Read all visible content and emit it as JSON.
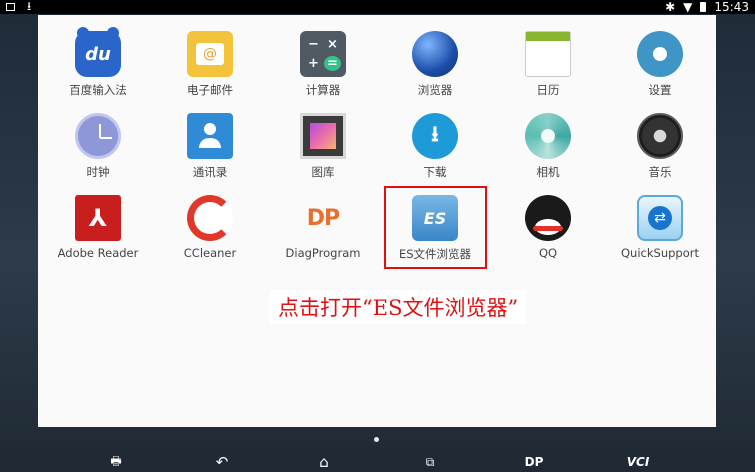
{
  "status_bar": {
    "time": "15:43",
    "icons": [
      "notification-square-icon",
      "download-icon",
      "bluetooth-icon",
      "wifi-icon",
      "battery-icon"
    ]
  },
  "apps": [
    {
      "label": "百度输入法",
      "icon": "baidu-input-icon"
    },
    {
      "label": "电子邮件",
      "icon": "mail-icon"
    },
    {
      "label": "计算器",
      "icon": "calculator-icon"
    },
    {
      "label": "浏览器",
      "icon": "browser-globe-icon"
    },
    {
      "label": "日历",
      "icon": "calendar-icon"
    },
    {
      "label": "设置",
      "icon": "gear-icon"
    },
    {
      "label": "时钟",
      "icon": "clock-icon"
    },
    {
      "label": "通讯录",
      "icon": "contacts-icon"
    },
    {
      "label": "图库",
      "icon": "gallery-icon"
    },
    {
      "label": "下载",
      "icon": "download-icon"
    },
    {
      "label": "相机",
      "icon": "camera-icon"
    },
    {
      "label": "音乐",
      "icon": "music-icon"
    },
    {
      "label": "Adobe Reader",
      "icon": "adobe-reader-icon"
    },
    {
      "label": "CCleaner",
      "icon": "ccleaner-icon"
    },
    {
      "label": "DiagProgram",
      "icon": "dp-logo-icon",
      "glyph": "DP"
    },
    {
      "label": "ES文件浏览器",
      "icon": "es-file-explorer-icon",
      "glyph": "ES"
    },
    {
      "label": "QQ",
      "icon": "qq-penguin-icon"
    },
    {
      "label": "QuickSupport",
      "icon": "quicksupport-icon"
    }
  ],
  "annotation": {
    "text": "点击打开“ES文件浏览器”",
    "color": "#e01010"
  },
  "nav_bar": {
    "buttons": [
      {
        "name": "printer-icon",
        "glyph": "🖶"
      },
      {
        "name": "back-icon",
        "glyph": "↶"
      },
      {
        "name": "home-icon",
        "glyph": "⌂"
      },
      {
        "name": "recent-apps-icon",
        "glyph": "⧉"
      },
      {
        "name": "dp-shortcut",
        "text": "DP"
      },
      {
        "name": "vci-shortcut",
        "text": "VCI"
      }
    ]
  }
}
